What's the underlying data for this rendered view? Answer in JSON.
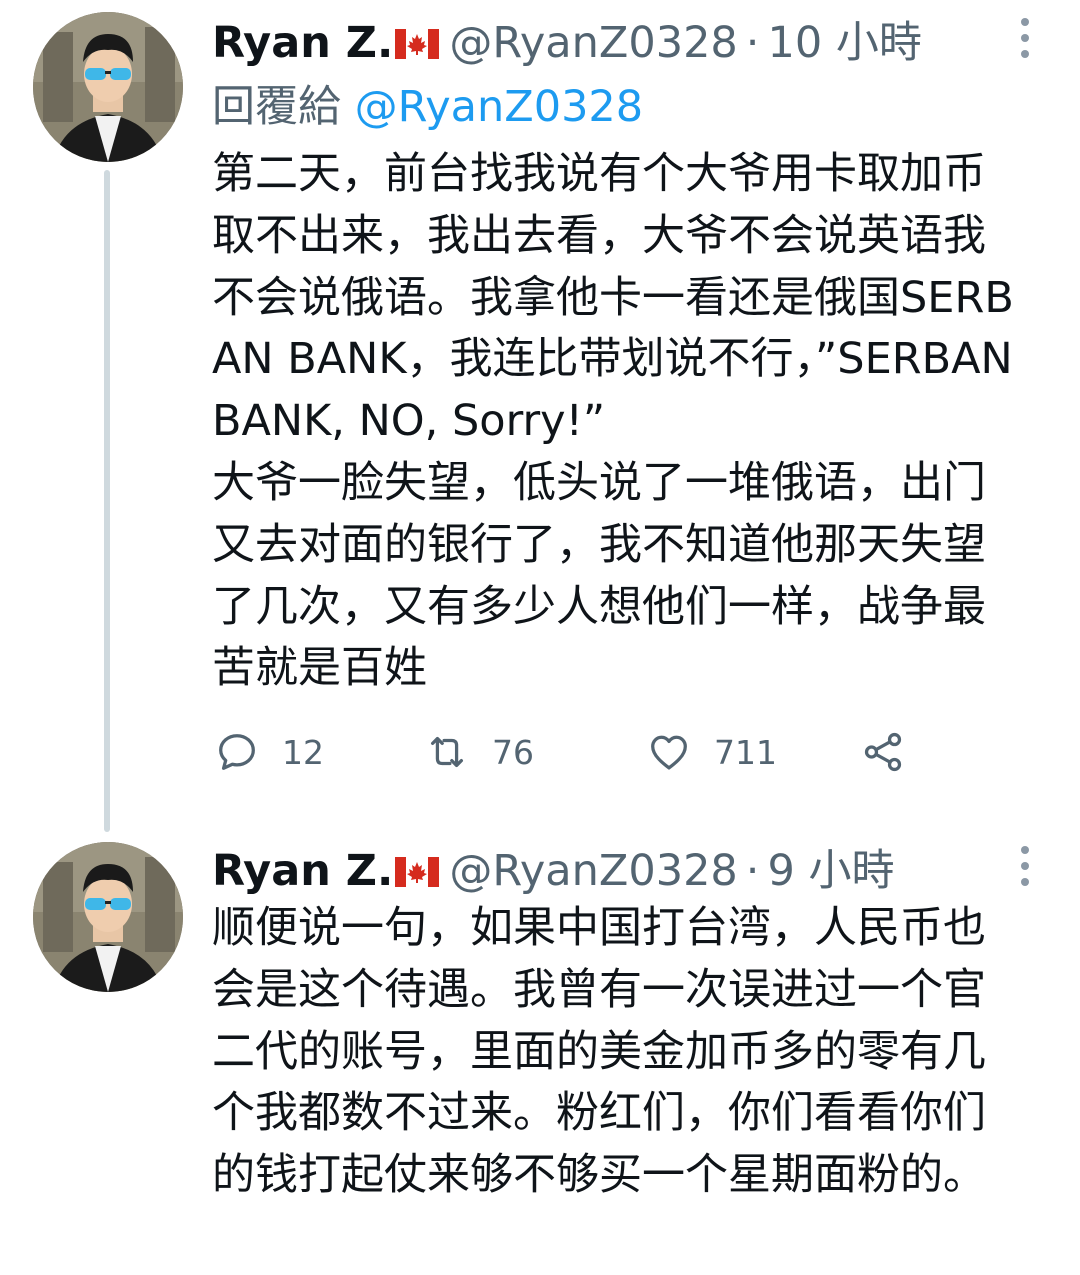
{
  "thread": [
    {
      "author_name": "Ryan Z.",
      "flag_icon": "canada-flag-icon",
      "handle": "@RyanZ0328",
      "separator": "·",
      "time": "10 小時",
      "reply_prefix": "回覆給",
      "reply_to": "@RyanZ0328",
      "text": "第二天，前台找我说有个大爷用卡取加币取不出来，我出去看，大爷不会说英语我不会说俄语。我拿他卡一看还是俄国SERBAN BANK，我连比带划说不行，”SERBAN BANK, NO, Sorry!”\n大爷一脸失望，低头说了一堆俄语，出门又去对面的银行了，我不知道他那天失望了几次，又有多少人想他们一样，战争最苦就是百姓",
      "reply_count": "12",
      "retweet_count": "76",
      "like_count": "711"
    },
    {
      "author_name": "Ryan Z.",
      "flag_icon": "canada-flag-icon",
      "handle": "@RyanZ0328",
      "separator": "·",
      "time": "9 小時",
      "text": "顺便说一句，如果中国打台湾，人民币也会是这个待遇。我曾有一次误进过一个官二代的账号，里面的美金加币多的零有几个我都数不过来。粉红们，你们看看你们的钱打起仗来够不够买一个星期面粉的。"
    }
  ],
  "colors": {
    "text_primary": "#0f1419",
    "text_secondary": "#536471",
    "link": "#1d9bf0",
    "thread_line": "#cfd9de"
  }
}
